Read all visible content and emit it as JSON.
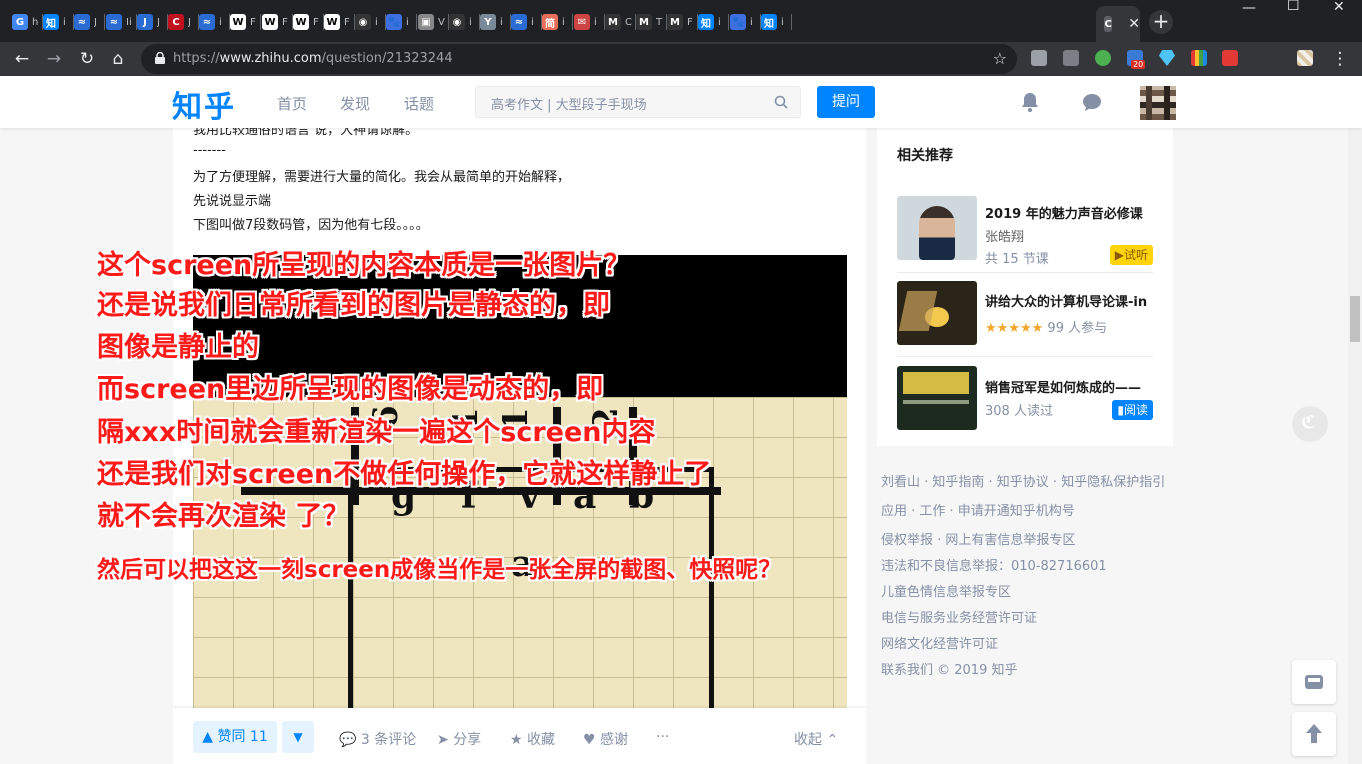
{
  "browser": {
    "tabs": [
      {
        "icon": "G",
        "color": "#4285f4",
        "title": "h"
      },
      {
        "icon": "知",
        "color": "#0084ff",
        "title": "i"
      },
      {
        "icon": "≈",
        "color": "#2a6bd4",
        "title": "J"
      },
      {
        "icon": "≈",
        "color": "#2a6bd4",
        "title": "Ii"
      },
      {
        "icon": "J",
        "color": "#2a6bd4",
        "title": "J"
      },
      {
        "icon": "C",
        "color": "#c0111f",
        "title": "J"
      },
      {
        "icon": "≈",
        "color": "#2a6bd4",
        "title": "i"
      },
      {
        "icon": "W",
        "color": "#ffffff",
        "title": "F"
      },
      {
        "icon": "W",
        "color": "#ffffff",
        "title": "F"
      },
      {
        "icon": "W",
        "color": "#ffffff",
        "title": "F"
      },
      {
        "icon": "W",
        "color": "#ffffff",
        "title": "F"
      },
      {
        "icon": "◉",
        "color": "#333333",
        "title": "i"
      },
      {
        "icon": "🐾",
        "color": "#3c6fe0",
        "title": "i"
      },
      {
        "icon": "▣",
        "color": "#888888",
        "title": "V"
      },
      {
        "icon": "◉",
        "color": "#333333",
        "title": "i"
      },
      {
        "icon": "Y",
        "color": "#7a8a99",
        "title": "i"
      },
      {
        "icon": "≈",
        "color": "#2a6bd4",
        "title": "i"
      },
      {
        "icon": "简",
        "color": "#ea6f5a",
        "title": "i"
      },
      {
        "icon": "✉",
        "color": "#c44",
        "title": "i"
      },
      {
        "icon": "M",
        "color": "#333333",
        "title": "C"
      },
      {
        "icon": "M",
        "color": "#333333",
        "title": "T"
      },
      {
        "icon": "M",
        "color": "#333333",
        "title": "F"
      },
      {
        "icon": "知",
        "color": "#0084ff",
        "title": "i"
      },
      {
        "icon": "🐾",
        "color": "#3c6fe0",
        "title": "i"
      },
      {
        "icon": "知",
        "color": "#0084ff",
        "title": "i"
      }
    ],
    "active_tab": {
      "icon": "C",
      "title": "C"
    },
    "url_prefix": "https://",
    "url_host": "www.zhihu.com",
    "url_path": "/question/21323244",
    "ext_badge": "20"
  },
  "header": {
    "logo": "知乎",
    "nav": [
      "首页",
      "发现",
      "话题"
    ],
    "search_placeholder": "高考作文 | 大型段子手现场",
    "ask_button": "提问"
  },
  "answer": {
    "lines": [
      "我用比较通俗的语言 说，大神请谅解。",
      "-------",
      "为了方便理解，需要进行大量的简化。我会从最简单的开始解释，",
      "先说说显示端",
      "下图叫做7段数码管，因为他有七段。。。。"
    ],
    "image_letters": [
      "g",
      "f",
      "v",
      "a",
      "b"
    ],
    "image_bottom_letter": "a",
    "vote_label": "▲ 赞同 11",
    "vote_down": "▼",
    "actions": {
      "comments": "3 条评论",
      "share": "分享",
      "collect": "收藏",
      "thanks": "感谢",
      "more": "···",
      "collapse": "收起"
    }
  },
  "sidebar": {
    "title": "相关推荐",
    "items": [
      {
        "title": "2019 年的魅力声音必修课",
        "sub": "张皓翔",
        "meta": "共 15 节课",
        "badge": "▶试听"
      },
      {
        "title": "讲给大众的计算机导论课-in",
        "sub": "",
        "meta": "99 人参与",
        "stars": "★★★★★",
        "badge": ""
      },
      {
        "title": "销售冠军是如何炼成的——",
        "sub": "",
        "meta": "308 人读过",
        "badge": "▮阅读"
      }
    ],
    "footer": [
      "刘看山 · 知乎指南 · 知乎协议 · 知乎隐私保护指引",
      "应用 · 工作 · 申请开通知乎机构号",
      "侵权举报 · 网上有害信息举报专区",
      "违法和不良信息举报：010-82716601",
      "儿童色情信息举报专区",
      "电信与服务业务经营许可证",
      "网络文化经营许可证",
      "联系我们 © 2019 知乎"
    ]
  },
  "annotation": {
    "lines": [
      "这个screen所呈现的内容本质是一张图片？",
      "还是说我们日常所看到的图片是静态的，即",
      "图像是静止的",
      "而screen里边所呈现的图像是动态的，即",
      "隔xxx时间就会重新渲染一遍这个screen内容",
      "还是我们对screen不做任何操作，它就这样静止了",
      "就不会再次渲染 了？"
    ],
    "last_line": "然后可以把这这一刻screen成像当作是一张全屏的截图、快照呢？",
    "color": "#ff1a1a"
  }
}
